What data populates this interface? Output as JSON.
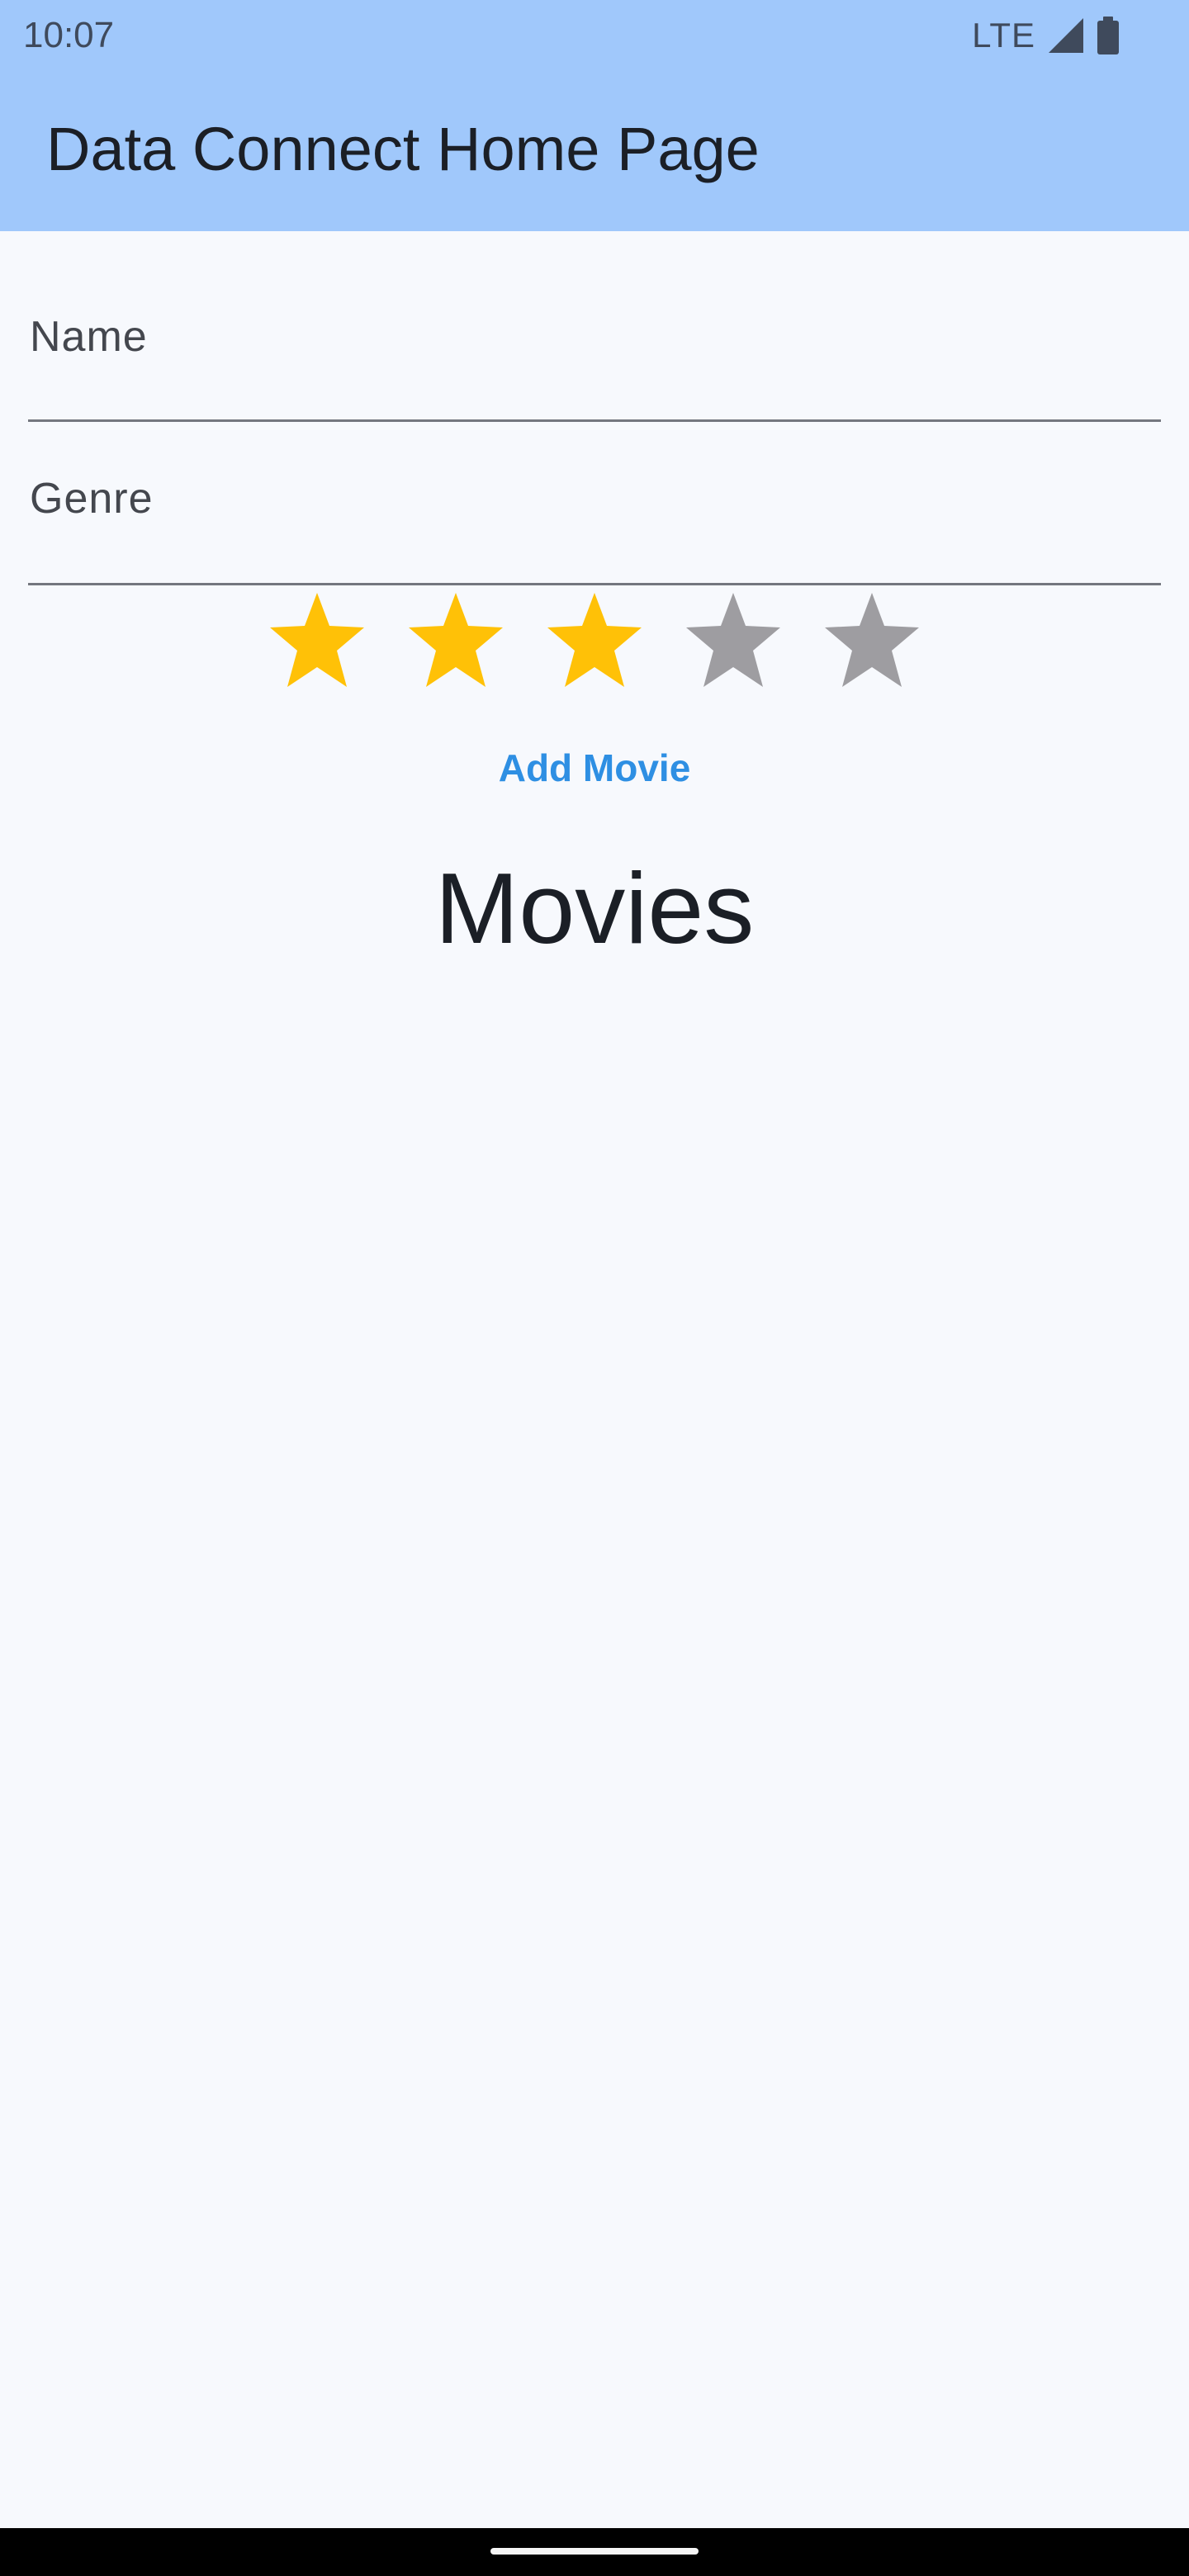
{
  "status_bar": {
    "time": "10:07",
    "network": "LTE",
    "icons": [
      "signal-icon",
      "battery-icon"
    ]
  },
  "app_bar": {
    "title": "Data Connect Home Page",
    "color": "#a0c8fb"
  },
  "form": {
    "name_label": "Name",
    "name_value": "",
    "genre_label": "Genre",
    "genre_value": ""
  },
  "rating": {
    "value": 3,
    "max": 5,
    "filled_color": "#ffc107",
    "empty_color": "#9e9da1"
  },
  "actions": {
    "add_movie_label": "Add Movie",
    "accent_color": "#2e8fe3"
  },
  "movies": {
    "title": "Movies",
    "items": []
  }
}
